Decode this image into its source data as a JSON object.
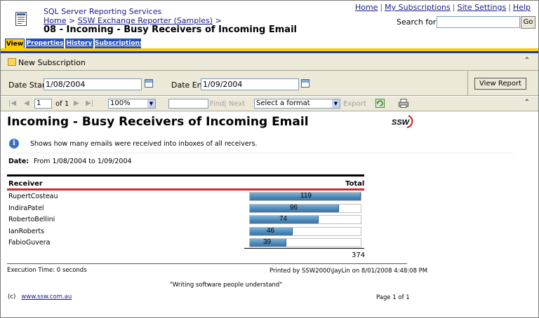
{
  "header": {
    "app_name": "SQL Server Reporting Services",
    "breadcrumb": {
      "home": "Home",
      "sep": ">",
      "folder": "SSW Exchange Reporter (Samples)",
      "trail": ">"
    },
    "report_title": "08 - Incoming - Busy Receivers of Incoming Email",
    "links": [
      "Home",
      "My Subscriptions",
      "Site Settings",
      "Help"
    ],
    "search": {
      "label": "Search for:",
      "value": "",
      "button": "Go"
    }
  },
  "tabs": [
    {
      "label": "View",
      "active": true
    },
    {
      "label": "Properties",
      "active": false
    },
    {
      "label": "History",
      "active": false
    },
    {
      "label": "Subscriptions",
      "active": false
    }
  ],
  "subscription_bar": {
    "new_subscription": "New Subscription"
  },
  "params": {
    "date_start_label": "Date Start",
    "date_start_value": "1/08/2004",
    "date_end_label": "Date End",
    "date_end_value": "1/09/2004",
    "view_report": "View Report"
  },
  "toolbar": {
    "page": "1",
    "of_pages": "of 1",
    "zoom": "100%",
    "find_text": "",
    "find": "Find",
    "next": "Next",
    "format": "Select a format",
    "export": "Export"
  },
  "report": {
    "title": "Incoming - Busy Receivers of Incoming Email",
    "logo_text": "SSW",
    "description": "Shows how many emails were received into inboxes of all receivers.",
    "date_label": "Date:",
    "date_range": "From 1/08/2004 to 1/09/2004",
    "columns": {
      "receiver": "Receiver",
      "total": "Total"
    },
    "grand_total": "374",
    "execution_time": "Execution Time: 0 seconds",
    "printed_by": "Printed by SSW2000\\JayLin on 8/01/2008 4:48:08 PM",
    "slogan": "\"Writing software people understand\"",
    "copyright_symbol": "(c)",
    "site_link": "www.ssw.com.au",
    "page_count": "Page 1 of 1"
  },
  "chart_data": {
    "type": "bar",
    "categories": [
      "RupertCosteau",
      "IndiraPatel",
      "RobertoBellini",
      "IanRoberts",
      "FabioGuvera"
    ],
    "values": [
      119,
      96,
      74,
      46,
      39
    ],
    "xlim": [
      0,
      119
    ],
    "bar_color": "#5b95c2"
  },
  "colors": {
    "tab_active": "#ffcc00",
    "tab_inactive": "#2450b4",
    "toolbar_bg": "#ece9d8",
    "accent_red": "#d8272a"
  }
}
